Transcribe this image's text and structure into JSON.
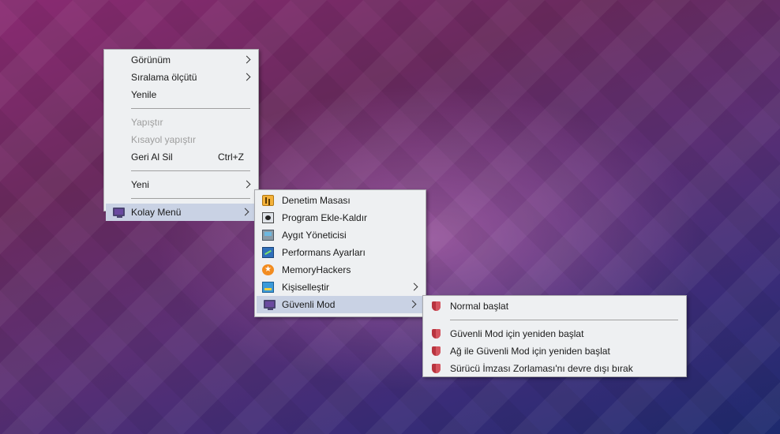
{
  "desktop_menu": {
    "items": [
      {
        "label": "Görünüm",
        "submenu": true
      },
      {
        "label": "Sıralama ölçütü",
        "submenu": true
      },
      {
        "label": "Yenile"
      },
      {
        "label": "Yapıştır",
        "disabled": true
      },
      {
        "label": "Kısayol yapıştır",
        "disabled": true
      },
      {
        "label": "Geri Al Sil",
        "shortcut": "Ctrl+Z"
      },
      {
        "label": "Yeni",
        "submenu": true
      },
      {
        "label": "Kolay Menü",
        "submenu": true,
        "icon": "monitor-icon",
        "active": true
      }
    ]
  },
  "kolay_menu": {
    "items": [
      {
        "label": "Denetim Masası",
        "icon": "control-panel-icon"
      },
      {
        "label": "Program Ekle-Kaldır",
        "icon": "program-icon"
      },
      {
        "label": "Aygıt Yöneticisi",
        "icon": "device-manager-icon"
      },
      {
        "label": "Performans Ayarları",
        "icon": "performance-icon"
      },
      {
        "label": "MemoryHackers",
        "icon": "star-icon",
        "glyph": "★"
      },
      {
        "label": "Kişiselleştir",
        "icon": "personalize-icon",
        "submenu": true
      },
      {
        "label": "Güvenli Mod",
        "icon": "monitor-icon",
        "submenu": true,
        "active": true
      }
    ]
  },
  "safe_mode_menu": {
    "items": [
      {
        "label": "Normal başlat",
        "icon": "shield-icon"
      },
      {
        "label": "Güvenli Mod için yeniden başlat",
        "icon": "shield-icon"
      },
      {
        "label": "Ağ ile Güvenli Mod için yeniden başlat",
        "icon": "shield-icon"
      },
      {
        "label": "Sürücü İmzası Zorlaması'nı devre dışı bırak",
        "icon": "shield-icon"
      }
    ]
  },
  "colors": {
    "menu_bg": "#eef0f2",
    "highlight": "#c9d2e4",
    "disabled_text": "#9d9d9d",
    "shield": "#b8343f"
  }
}
